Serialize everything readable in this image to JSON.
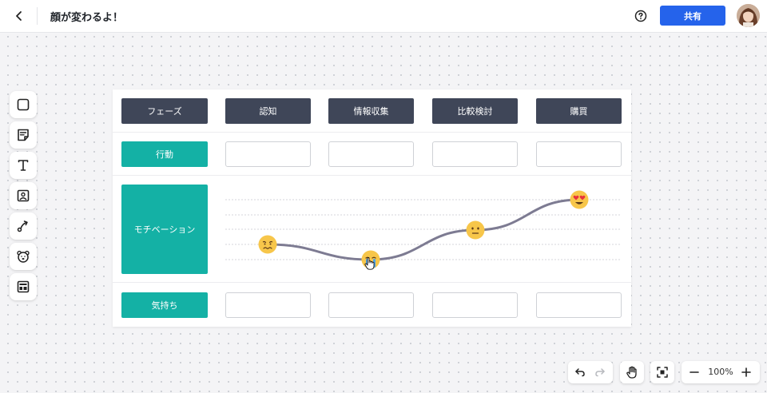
{
  "header": {
    "title": "顔が変わるよ！",
    "share_label": "共有"
  },
  "board": {
    "corner_label": "フェーズ",
    "phases": [
      "認知",
      "情報収集",
      "比較検討",
      "購買"
    ],
    "rows": {
      "action": "行動",
      "motivation": "モチベーション",
      "feeling": "気持ち"
    },
    "motivation_emotions": [
      "sad-face",
      "crying-face",
      "neutral-face",
      "heart-eyes-face"
    ]
  },
  "zoom": {
    "level": "100%"
  },
  "colors": {
    "accent_blue": "#2563eb",
    "phase_header": "#3f4658",
    "row_label": "#14b1a5",
    "curve": "#7d7b92",
    "emoji_yellow": "#f7c64a"
  },
  "icons": {
    "toolbar": [
      "shape-icon",
      "sticky-note-icon",
      "text-icon",
      "image-icon",
      "connector-icon",
      "character-icon",
      "template-icon"
    ]
  }
}
